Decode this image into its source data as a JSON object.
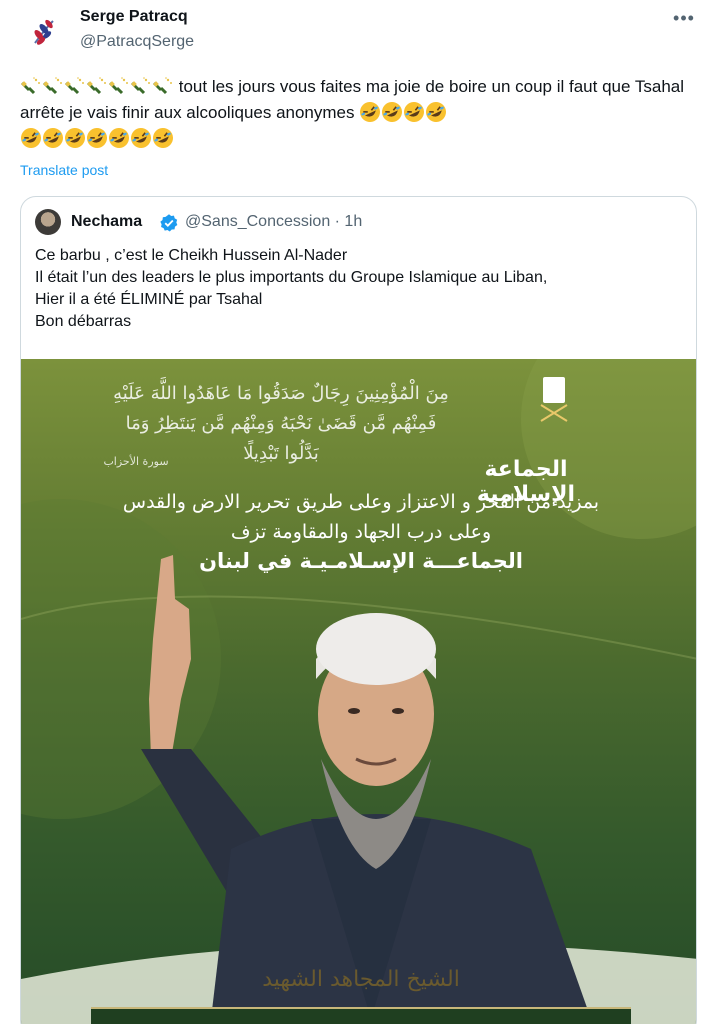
{
  "author": {
    "name": "Serge Patracq",
    "handle": "@PatracqSerge",
    "avatar_icon": "olive-branch-icon"
  },
  "menu": {
    "more_label": "•••"
  },
  "post": {
    "bottle_emoji_count": 7,
    "text": "tout les jours vous faites ma joie de boire un coup il faut que Tsahal arrête je vais finir aux alcooliques anonymes",
    "rofl_emoji_count_line": 4,
    "rofl_emoji_count_after": 7,
    "translate_label": "Translate post"
  },
  "quote": {
    "name": "Nechama",
    "handle_time": "@Sans_Concession · 1h",
    "text_lines": [
      "Ce barbu , c’est le Cheikh Hussein Al-Nader",
      "Il était l’un des leaders le plus importants du Groupe Islamique au Liban,",
      "Hier il a été ÉLIMINÉ par Tsahal",
      "Bon débarras"
    ],
    "media": {
      "quran_verse": "مِنَ الْمُؤْمِنِينَ رِجَالٌ صَدَقُوا مَا عَاهَدُوا اللَّهَ عَلَيْهِ فَمِنْهُم مَّن قَضَىٰ نَحْبَهُ وَمِنْهُم مَّن يَنتَظِرُ وَمَا بَدَّلُوا تَبْدِيلًا",
      "sura": "سورة الأحزاب",
      "group_name": "الجماعة الإسلامية",
      "line1": "بمزيد من الفخر و الاعتزاز وعلى طريق تحرير الارض والقدس",
      "line2": "وعلى درب الجهاد والمقاومة تزف",
      "line3": "الجماعـــة الإسـلامـيـة في لبنان",
      "title": "الشيخ المجاهد الشهيد"
    }
  },
  "colors": {
    "link": "#1d9bf0",
    "verified": "#1d9bf0",
    "secondary_text": "#536471",
    "border": "#cfd9de"
  }
}
